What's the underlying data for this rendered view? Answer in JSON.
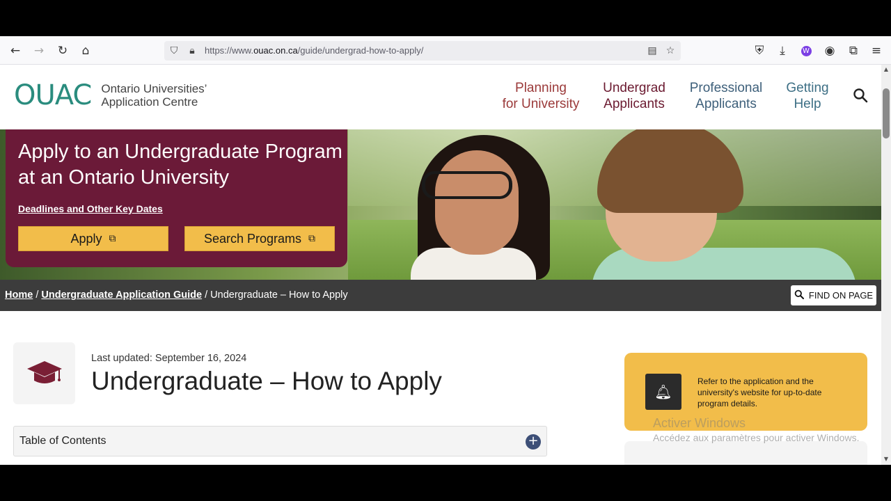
{
  "browser": {
    "url_prefix": "https://www.",
    "url_domain": "ouac.on.ca",
    "url_path": "/guide/undergrad-how-to-apply/"
  },
  "header": {
    "logo_mark": "OUAC",
    "logo_line1": "Ontario Universities’",
    "logo_line2": "Application Centre",
    "nav": {
      "planning_1": "Planning",
      "planning_2": "for University",
      "undergrad_1": "Undergrad",
      "undergrad_2": "Applicants",
      "professional_1": "Professional",
      "professional_2": "Applicants",
      "help_1": "Getting",
      "help_2": "Help"
    }
  },
  "hero": {
    "title": "Apply to an Undergraduate Program at an Ontario University",
    "deadlines_link": "Deadlines and Other Key Dates",
    "apply_label": "Apply",
    "search_label": "Search Programs"
  },
  "breadcrumb": {
    "home": "Home",
    "separator": "/",
    "guide": "Undergraduate Application Guide",
    "current": "Undergraduate – How to Apply",
    "find_label": "FIND ON PAGE"
  },
  "content": {
    "last_updated": "Last updated: September 16, 2024",
    "title": "Undergraduate – How to Apply",
    "toc_label": "Table of Contents"
  },
  "notice": {
    "text": "Refer to the application and the university's website for up-to-date program details."
  },
  "windows_watermark": {
    "line1": "Activer Windows",
    "line2": "Accédez aux paramètres pour activer Windows."
  },
  "colors": {
    "brand_maroon": "#6b1a38",
    "button_yellow": "#f2bd4a",
    "crumb_bar": "#3c3c3c",
    "toc_plus": "#3d4f77"
  },
  "icons": {
    "back": "back-arrow-icon",
    "forward": "forward-arrow-icon",
    "reload": "reload-icon",
    "home": "home-icon",
    "shield": "shield-icon",
    "lock": "lock-icon",
    "reader": "reader-view-icon",
    "star": "bookmark-star-icon",
    "pocket": "pocket-icon",
    "download": "download-icon",
    "extension_w": "extension-w-icon",
    "account": "account-icon",
    "extensions": "extensions-puzzle-icon",
    "menu": "menu-icon",
    "search": "search-icon",
    "external": "external-link-icon",
    "mortarboard": "graduation-cap-icon",
    "bell": "bell-icon",
    "plus": "plus-circle-icon"
  }
}
